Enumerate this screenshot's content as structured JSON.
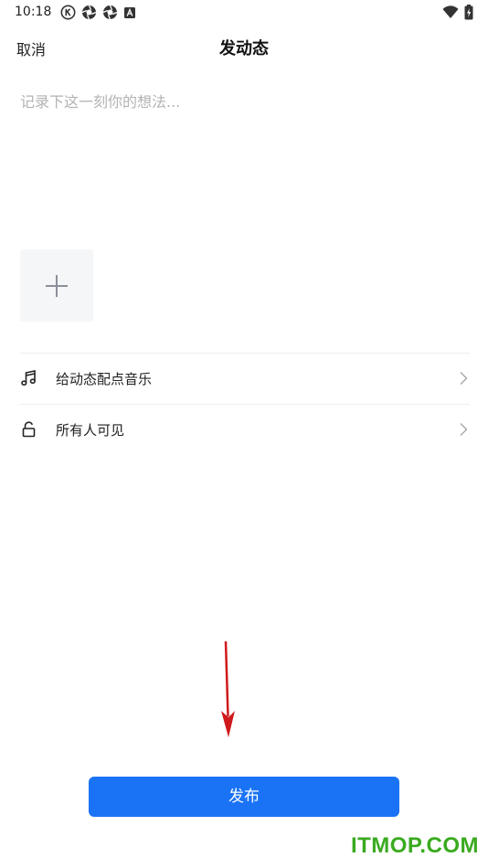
{
  "status_bar": {
    "time": "10:18",
    "icons_left": [
      "k-circle-icon",
      "aperture-icon",
      "aperture-icon",
      "a-box-icon"
    ],
    "icons_right": [
      "wifi-icon",
      "battery-charging-icon"
    ]
  },
  "header": {
    "cancel_label": "取消",
    "title": "发动态"
  },
  "composer": {
    "placeholder": "记录下这一刻你的想法...",
    "value": "",
    "add_media_icon": "plus-icon"
  },
  "options": [
    {
      "icon": "music-note-icon",
      "label": "给动态配点音乐",
      "chevron": "chevron-right-icon"
    },
    {
      "icon": "unlock-icon",
      "label": "所有人可见",
      "chevron": "chevron-right-icon"
    }
  ],
  "footer": {
    "publish_label": "发布"
  },
  "watermark": {
    "text": "ITMOP.COM"
  },
  "colors": {
    "accent": "#1a73f5",
    "placeholder": "#b3b3b3",
    "add_media_bg": "#f5f6f8",
    "annotation_arrow": "#d0191b",
    "watermark": "#3aaa1f"
  }
}
